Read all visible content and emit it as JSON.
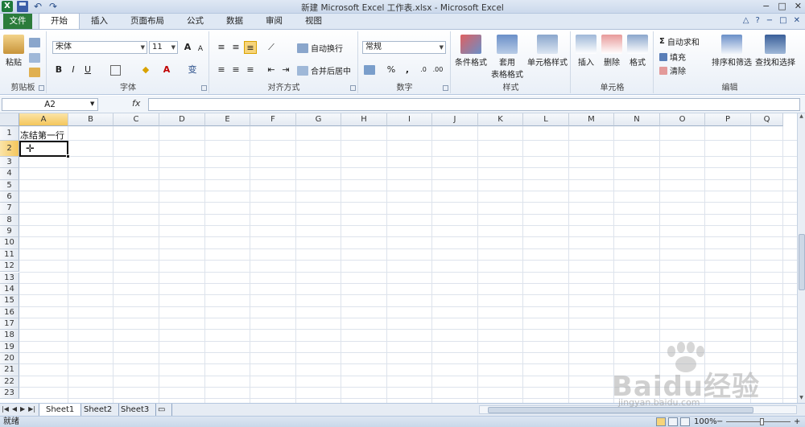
{
  "window": {
    "title": "新建 Microsoft Excel 工作表.xlsx - Microsoft Excel",
    "app_icon": "X",
    "controls": [
      "−",
      "□",
      "✕"
    ]
  },
  "ribbon_tabs": [
    "文件",
    "开始",
    "插入",
    "页面布局",
    "公式",
    "数据",
    "审阅",
    "视图"
  ],
  "ribbon": {
    "clipboard": {
      "label": "剪贴板",
      "paste": "粘贴"
    },
    "font": {
      "label": "字体",
      "font_name": "宋体",
      "font_size": "11",
      "bold": "B",
      "italic": "I",
      "underline": "U",
      "grow": "A",
      "shrink": "A",
      "wen": "变"
    },
    "alignment": {
      "label": "对齐方式",
      "wrap": "自动换行",
      "merge": "合并后居中"
    },
    "number": {
      "label": "数字",
      "format": "常规",
      "percent": "%",
      "comma": ","
    },
    "styles": {
      "label": "样式",
      "cond_format": "条件格式",
      "table_format_1": "套用",
      "table_format_2": "表格格式",
      "cell_styles": "单元格样式"
    },
    "cells": {
      "label": "单元格",
      "insert": "插入",
      "delete": "删除",
      "format": "格式"
    },
    "editing": {
      "label": "编辑",
      "autosum": "自动求和",
      "fill": "填充",
      "clear": "清除",
      "sort_filter": "排序和筛选",
      "find_select": "查找和选择",
      "sigma": "Σ"
    }
  },
  "formula_bar": {
    "name_box": "A2",
    "fx": "fx",
    "content": ""
  },
  "grid": {
    "columns": [
      "A",
      "B",
      "C",
      "D",
      "E",
      "F",
      "G",
      "H",
      "I",
      "J",
      "K",
      "L",
      "M",
      "N",
      "O",
      "P",
      "Q"
    ],
    "rows": [
      "1",
      "2",
      "3",
      "4",
      "5",
      "6",
      "7",
      "8",
      "9",
      "10",
      "11",
      "12",
      "13",
      "14",
      "15",
      "16",
      "17",
      "18",
      "19",
      "20",
      "21",
      "22",
      "23"
    ],
    "cell_a1": "冻结第一行",
    "active_cell": "A2"
  },
  "sheets": [
    "Sheet1",
    "Sheet2",
    "Sheet3"
  ],
  "status": {
    "ready": "就绪",
    "zoom": "100%",
    "minus": "−",
    "plus": "+"
  },
  "watermark": {
    "brand": "Baidu经验",
    "url": "jingyan.baidu.com"
  },
  "colors": {
    "file_tab": "#2b7c3b",
    "selection": "#f4c65b",
    "ribbon_bg": "#dfe8f4"
  }
}
